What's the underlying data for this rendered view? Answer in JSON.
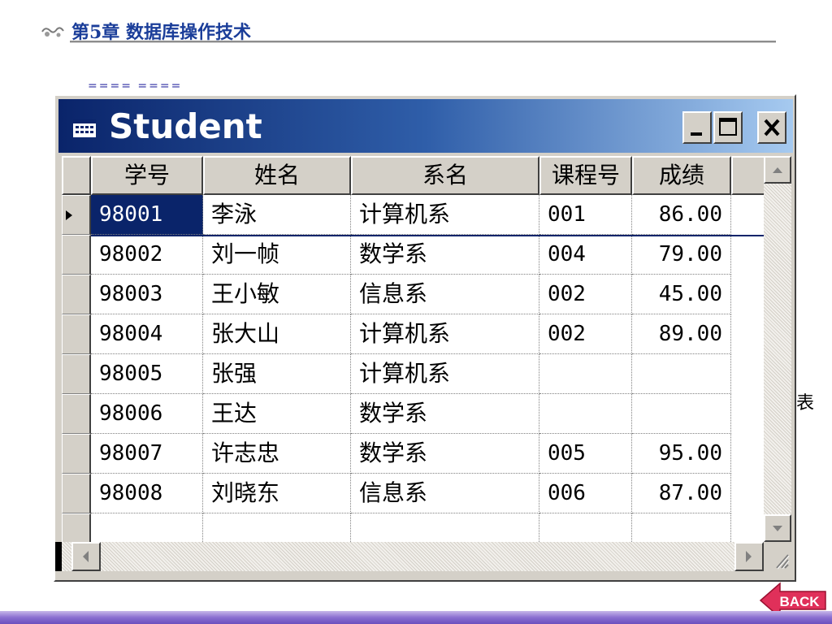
{
  "slide": {
    "header_title": "第5章  数据库操作技术",
    "stray_text": "==== ====",
    "side_text": "表",
    "back_label": "BACK"
  },
  "window": {
    "title": "Student",
    "title_icon": "grid-window-icon",
    "buttons": {
      "minimize": "minimize-icon",
      "maximize": "maximize-icon",
      "close": "close-icon"
    }
  },
  "table": {
    "columns": [
      "学号",
      "姓名",
      "系名",
      "课程号",
      "成绩"
    ],
    "rows": [
      [
        "98001",
        "李泳",
        "计算机系",
        "001",
        "86.00"
      ],
      [
        "98002",
        "刘一帧",
        "数学系",
        "004",
        "79.00"
      ],
      [
        "98003",
        "王小敏",
        "信息系",
        "002",
        "45.00"
      ],
      [
        "98004",
        "张大山",
        "计算机系",
        "002",
        "89.00"
      ],
      [
        "98005",
        "张强",
        "计算机系",
        "",
        ""
      ],
      [
        "98006",
        "王达",
        "数学系",
        "",
        ""
      ],
      [
        "98007",
        "许志忠",
        "数学系",
        "005",
        "95.00"
      ],
      [
        "98008",
        "刘晓东",
        "信息系",
        "006",
        "87.00"
      ],
      [
        "",
        "",
        "",
        "",
        ""
      ]
    ],
    "current_row_index": 0
  },
  "colors": {
    "title_gradient_start": "#0a246a",
    "title_gradient_end": "#a6caf0",
    "header_text": "#1a3d99",
    "back_button": "#e0305a"
  }
}
